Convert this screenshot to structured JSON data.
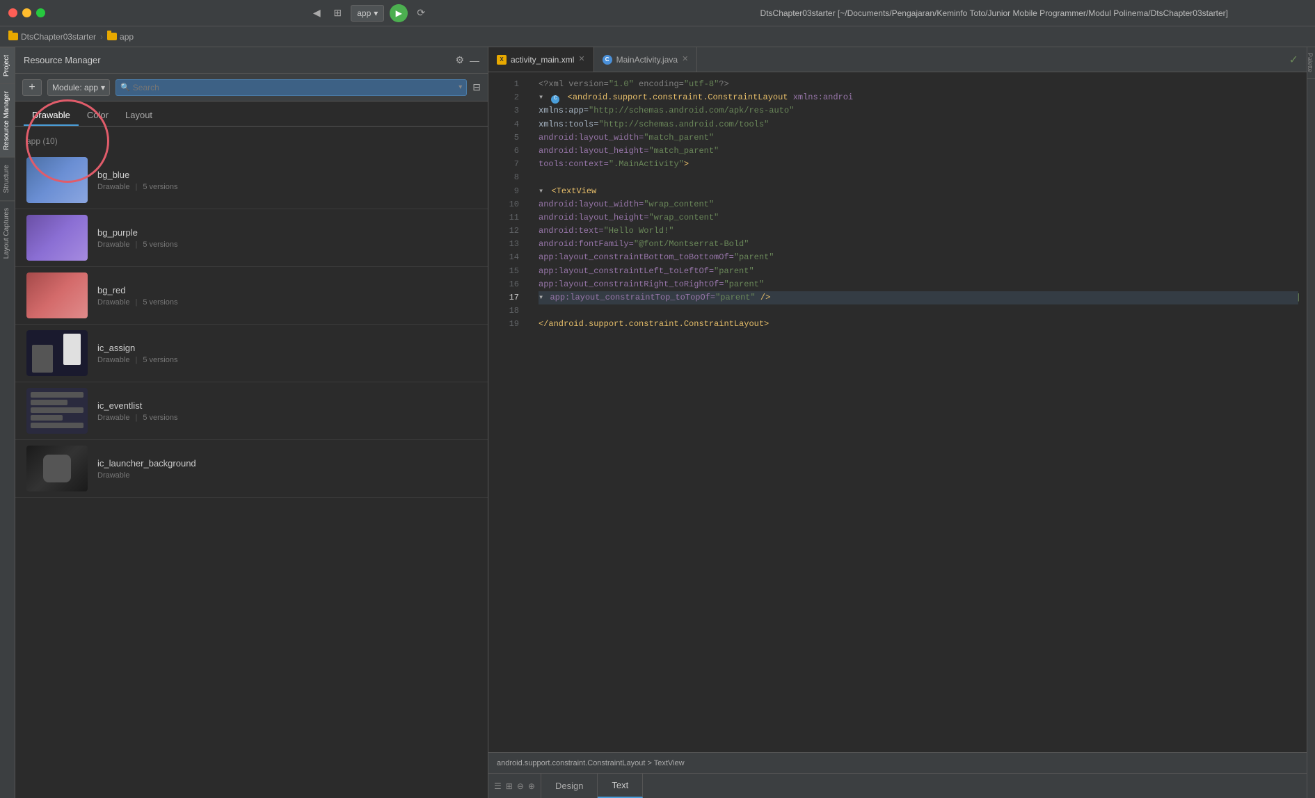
{
  "window": {
    "title": "DtsChapter03starter [~/Documents/Pengajaran/Keminfo Toto/Junior Mobile Programmer/Modul Polinema/DtsChapter03starter]",
    "traffic_lights": [
      "close",
      "minimize",
      "maximize"
    ]
  },
  "breadcrumb": {
    "items": [
      {
        "label": "DtsChapter03starter",
        "type": "folder"
      },
      {
        "label": "app",
        "type": "folder"
      }
    ]
  },
  "resource_manager": {
    "title": "Resource Manager",
    "tabs": [
      {
        "label": "Drawable",
        "active": true
      },
      {
        "label": "Color",
        "active": false
      },
      {
        "label": "Layout",
        "active": false
      }
    ],
    "module_label": "Module: app",
    "search_placeholder": "Search",
    "group": "app (10)",
    "items": [
      {
        "name": "bg_blue",
        "type": "Drawable",
        "versions": "5 versions",
        "thumb": "blue"
      },
      {
        "name": "bg_purple",
        "type": "Drawable",
        "versions": "5 versions",
        "thumb": "purple"
      },
      {
        "name": "bg_red",
        "type": "Drawable",
        "versions": "5 versions",
        "thumb": "red"
      },
      {
        "name": "ic_assign",
        "type": "Drawable",
        "versions": "5 versions",
        "thumb": "assign"
      },
      {
        "name": "ic_eventlist",
        "type": "Drawable",
        "versions": "5 versions",
        "thumb": "eventlist"
      },
      {
        "name": "ic_launcher_background",
        "type": "Drawable",
        "versions": "...",
        "thumb": "launcher"
      }
    ]
  },
  "editor": {
    "tabs": [
      {
        "label": "activity_main.xml",
        "type": "xml",
        "active": true
      },
      {
        "label": "MainActivity.java",
        "type": "java",
        "active": false
      }
    ],
    "lines": [
      {
        "num": 1,
        "code": "<?xml version=\"1.0\" encoding=\"utf-8\"?>"
      },
      {
        "num": 2,
        "code": "<android.support.constraint.ConstraintLayout xmlns:androi"
      },
      {
        "num": 3,
        "code": "    xmlns:app=\"http://schemas.android.com/apk/res-auto\""
      },
      {
        "num": 4,
        "code": "    xmlns:tools=\"http://schemas.android.com/tools\""
      },
      {
        "num": 5,
        "code": "    android:layout_width=\"match_parent\""
      },
      {
        "num": 6,
        "code": "    android:layout_height=\"match_parent\""
      },
      {
        "num": 7,
        "code": "    tools:context=\".MainActivity\">"
      },
      {
        "num": 8,
        "code": ""
      },
      {
        "num": 9,
        "code": "    <TextView"
      },
      {
        "num": 10,
        "code": "        android:layout_width=\"wrap_content\""
      },
      {
        "num": 11,
        "code": "        android:layout_height=\"wrap_content\""
      },
      {
        "num": 12,
        "code": "        android:text=\"Hello World!\""
      },
      {
        "num": 13,
        "code": "        android:fontFamily=\"@font/Montserrat-Bold\""
      },
      {
        "num": 14,
        "code": "        app:layout_constraintBottom_toBottomOf=\"parent\""
      },
      {
        "num": 15,
        "code": "        app:layout_constraintLeft_toLeftOf=\"parent\""
      },
      {
        "num": 16,
        "code": "        app:layout_constraintRight_toRightOf=\"parent\""
      },
      {
        "num": 17,
        "code": "        app:layout_constraintTop_toTopOf=\"parent\" />"
      },
      {
        "num": 18,
        "code": ""
      },
      {
        "num": 19,
        "code": "</android.support.constraint.ConstraintLayout>"
      }
    ],
    "bottom_path": "android.support.constraint.ConstraintLayout > TextView",
    "bottom_tabs": [
      {
        "label": "Design",
        "active": false
      },
      {
        "label": "Text",
        "active": true
      }
    ]
  },
  "sidebar": {
    "left_tabs": [
      "Project",
      "Resource Manager",
      "Structure",
      "Layout Captures"
    ],
    "right_tabs": [
      "Palette"
    ]
  },
  "toolbar": {
    "app_selector": "app",
    "run_label": "▶",
    "debug_label": "🐛"
  }
}
